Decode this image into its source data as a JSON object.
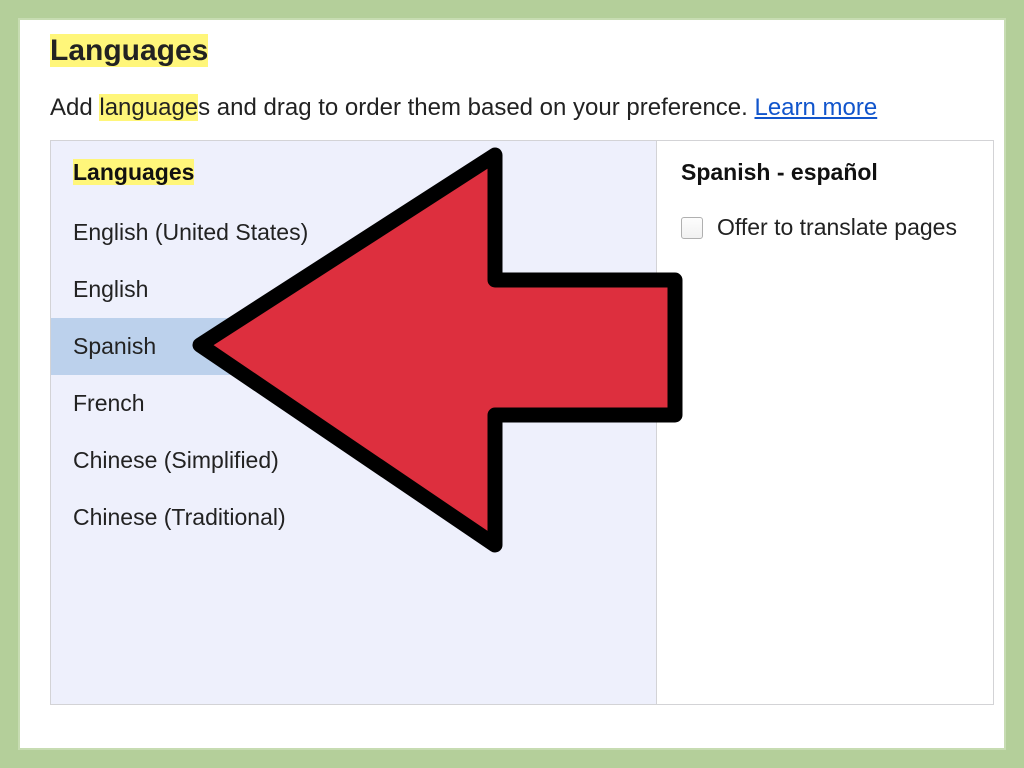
{
  "header": {
    "title": "Languages",
    "subtitle_prefix": "Add ",
    "subtitle_highlight": "language",
    "subtitle_suffix": "s and drag to order them based on your preference. ",
    "learn_more": "Learn more"
  },
  "left": {
    "heading": "Languages",
    "items": [
      {
        "label": "English (United States)",
        "selected": false
      },
      {
        "label": "English",
        "selected": false
      },
      {
        "label": "Spanish",
        "selected": true
      },
      {
        "label": "French",
        "selected": false
      },
      {
        "label": "Chinese (Simplified)",
        "selected": false
      },
      {
        "label": "Chinese (Traditional)",
        "selected": false
      }
    ]
  },
  "right": {
    "heading": "Spanish - español",
    "offer_translate_label": "Offer to translate pages",
    "offer_translate_checked": false
  },
  "colors": {
    "highlight": "#fff67a",
    "link": "#1155cc",
    "left_bg": "#eef0fc",
    "selected_bg": "#bcd1ec",
    "page_bg": "#b4cf9a",
    "arrow_fill": "#dd2f3e",
    "arrow_stroke": "#000000"
  }
}
